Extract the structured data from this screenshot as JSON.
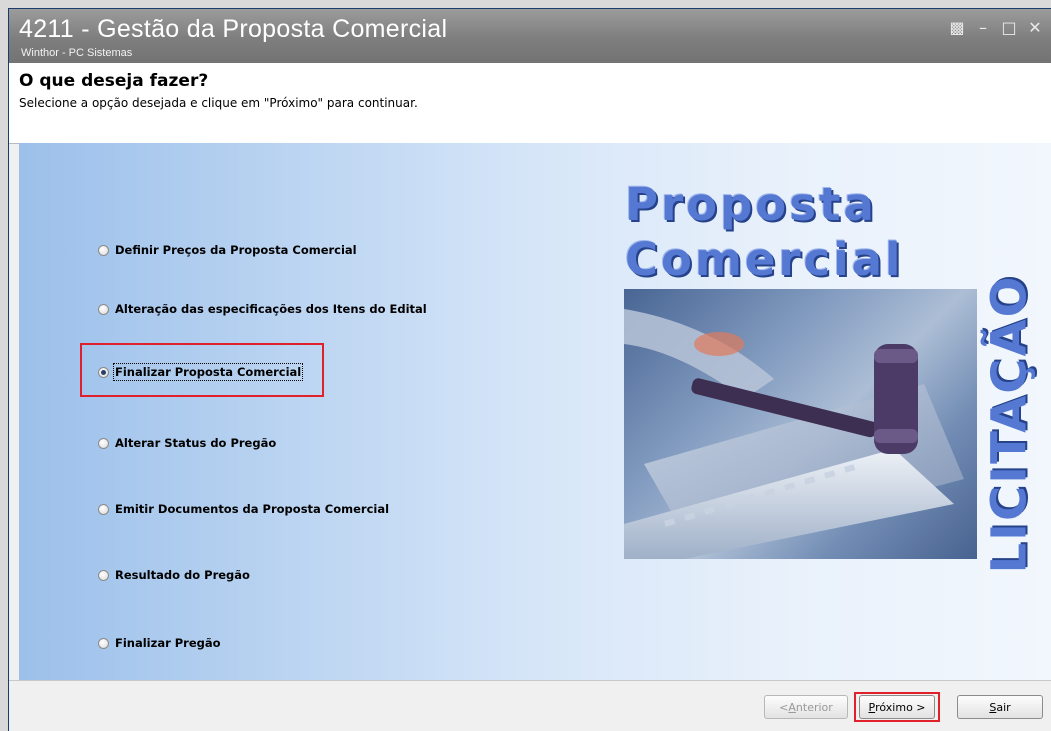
{
  "window": {
    "title": "4211 - Gestão da Proposta Comercial",
    "subtitle": "Winthor - PC Sistemas",
    "controls": [
      "restore",
      "minimize",
      "maximize",
      "close"
    ]
  },
  "header": {
    "heading": "O que deseja fazer?",
    "instruction": "Selecione a opção desejada e clique em \"Próximo\" para continuar."
  },
  "options": [
    {
      "label": "Definir Preços da Proposta Comercial",
      "checked": false
    },
    {
      "label": "Alteração das especificações dos Itens do Edital",
      "checked": false
    },
    {
      "label": "Finalizar Proposta Comercial",
      "checked": true
    },
    {
      "label": "Alterar Status do Pregão",
      "checked": false
    },
    {
      "label": "Emitir Documentos da Proposta Comercial",
      "checked": false
    },
    {
      "label": "Resultado do Pregão",
      "checked": false
    },
    {
      "label": "Finalizar Pregão",
      "checked": false
    }
  ],
  "banner": {
    "line1": "Proposta",
    "line2": "Comercial",
    "vertical": "LICITAÇÃO"
  },
  "buttons": {
    "anterior_pre": "< ",
    "anterior_key": "A",
    "anterior_rest": "nterior",
    "proximo_key": "P",
    "proximo_rest": "róximo >",
    "sair_key": "S",
    "sair_rest": "air"
  },
  "colors": {
    "highlight": "#e0202a",
    "titlebar": "#8a8a8a",
    "banner_text": "#5579d3"
  }
}
